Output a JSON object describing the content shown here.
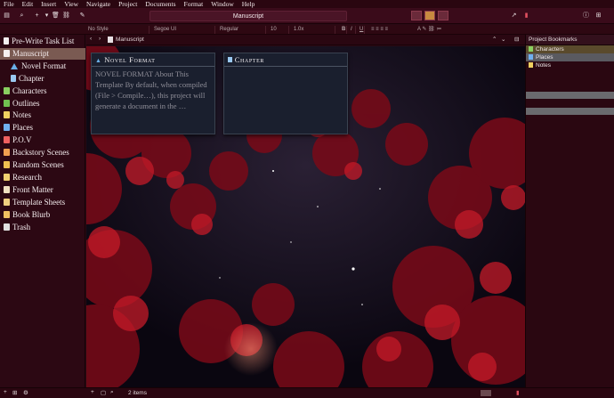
{
  "menu": [
    "File",
    "Edit",
    "Insert",
    "View",
    "Navigate",
    "Project",
    "Documents",
    "Format",
    "Window",
    "Help"
  ],
  "window_title": "Manuscript",
  "format": {
    "style": "No Style",
    "font": "Segoe UI",
    "weight": "Regular",
    "size": "10",
    "spacing": "1.0x",
    "bold": "B",
    "italic": "I",
    "underline": "U"
  },
  "binder": [
    {
      "label": "Pre-Write Task List",
      "icon": "page-icon",
      "color": "#f4f0f0",
      "indent": 0
    },
    {
      "label": "Manuscript",
      "icon": "folder-icon",
      "color": "#f4f0f0",
      "indent": 0,
      "selected": true
    },
    {
      "label": "Novel Format",
      "icon": "triangle-icon",
      "color": "#6ab0e8",
      "indent": 1
    },
    {
      "label": "Chapter",
      "icon": "page-icon",
      "color": "#9ac8f0",
      "indent": 1
    },
    {
      "label": "Characters",
      "icon": "folder-icon",
      "color": "#8ad060",
      "indent": 0
    },
    {
      "label": "Outlines",
      "icon": "folder-icon",
      "color": "#70c050",
      "indent": 0
    },
    {
      "label": "Notes",
      "icon": "folder-icon",
      "color": "#f0d060",
      "indent": 0
    },
    {
      "label": "Places",
      "icon": "folder-icon",
      "color": "#70b0f0",
      "indent": 0
    },
    {
      "label": "P.O.V",
      "icon": "folder-icon",
      "color": "#f06060",
      "indent": 0
    },
    {
      "label": "Backstory Scenes",
      "icon": "folder-icon",
      "color": "#f0a050",
      "indent": 0
    },
    {
      "label": "Random Scenes",
      "icon": "folder-icon",
      "color": "#f0c050",
      "indent": 0
    },
    {
      "label": "Research",
      "icon": "folder-icon",
      "color": "#f0d070",
      "indent": 0
    },
    {
      "label": "Front Matter",
      "icon": "folder-icon",
      "color": "#f0e0c0",
      "indent": 0
    },
    {
      "label": "Template Sheets",
      "icon": "folder-icon",
      "color": "#f0d080",
      "indent": 0
    },
    {
      "label": "Book Blurb",
      "icon": "folder-icon",
      "color": "#f0c060",
      "indent": 0
    },
    {
      "label": "Trash",
      "icon": "trash-icon",
      "color": "#e0e0e0",
      "indent": 0
    }
  ],
  "editor": {
    "breadcrumb": "Manuscript",
    "cards": [
      {
        "title": "Novel Format",
        "icon": "triangle-icon",
        "body": "NOVEL FORMAT About This Template By default, when compiled (File > Compile…), this project will generate a document in the …"
      },
      {
        "title": "Chapter",
        "icon": "page-icon",
        "body": ""
      }
    ]
  },
  "bookmarks": {
    "title": "Project Bookmarks",
    "items": [
      {
        "label": "Characters",
        "color": "#8ad060",
        "bg": "#5a4a2c"
      },
      {
        "label": "Places",
        "color": "#70b0f0",
        "bg": "#5a5a60"
      },
      {
        "label": "Notes",
        "color": "#f0d060",
        "bg": "#2a0711"
      }
    ]
  },
  "footer": {
    "status": "2 items"
  }
}
